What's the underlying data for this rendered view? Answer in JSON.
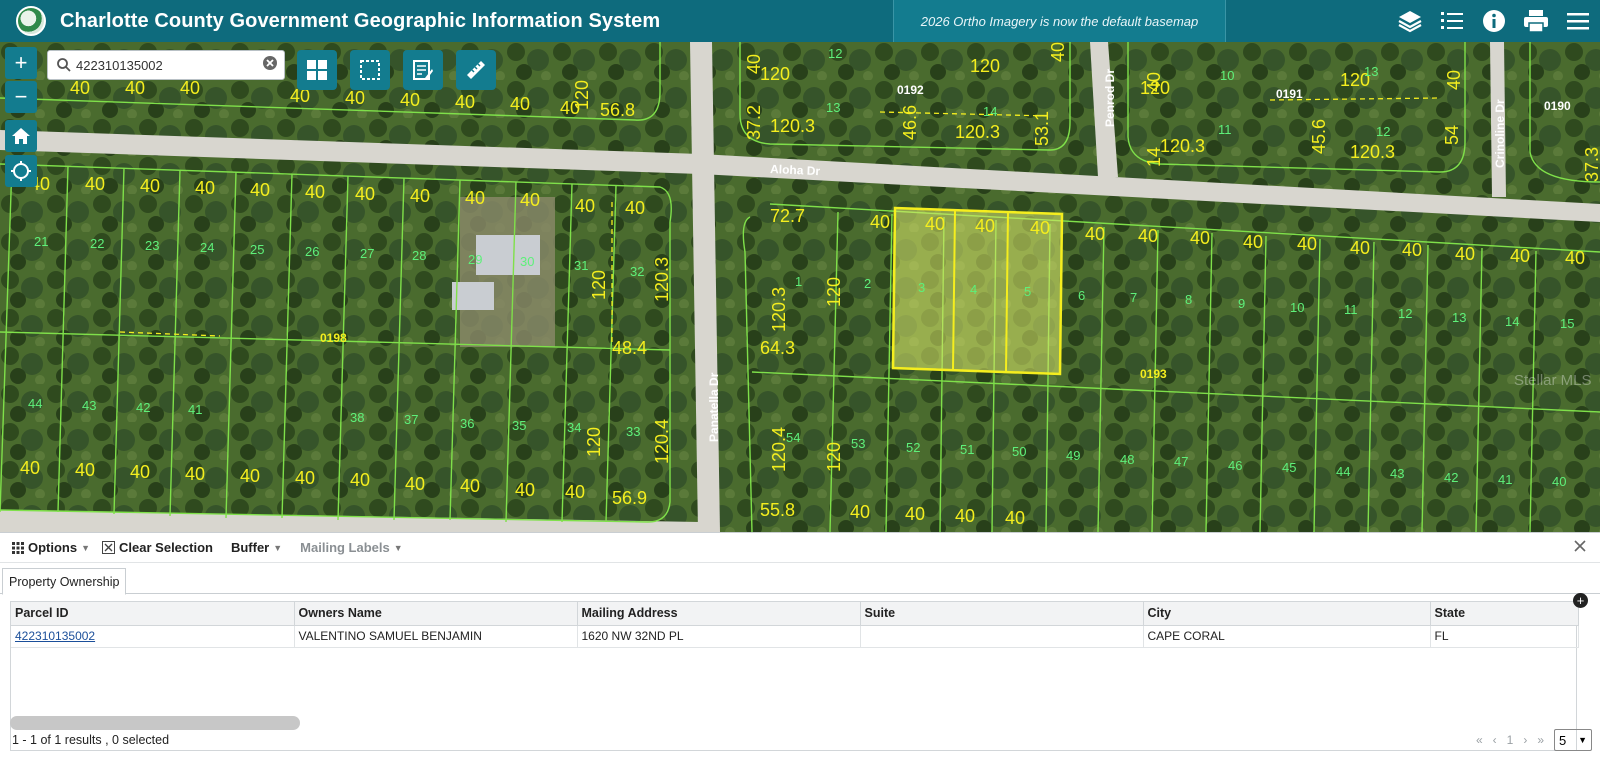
{
  "header": {
    "title": "Charlotte County Government Geographic Information System",
    "announcement": "2026 Ortho Imagery is now the default basemap",
    "icons": [
      "layers-icon",
      "list-icon",
      "info-icon",
      "print-icon",
      "menu-icon"
    ]
  },
  "map": {
    "zoom_in_label": "+",
    "zoom_out_label": "−",
    "search": {
      "value": "422310135002",
      "placeholder": "Search"
    },
    "tools": [
      "basemap-grid-icon",
      "select-area-icon",
      "notes-icon",
      "measure-icon"
    ],
    "streets": [
      "Aloha Dr",
      "Panatella Dr",
      "Penrod Dr",
      "Crinoline Dr"
    ],
    "blocks": [
      "0192",
      "0191",
      "0190",
      "0198",
      "0193"
    ],
    "watermark": "Stellar MLS",
    "colors": {
      "parcel_lines": "#7fe04a",
      "dimension_labels": "#f5ee1e",
      "selected_fill": "#d9e66a"
    }
  },
  "panel": {
    "toolbar": {
      "options": "Options",
      "clear_selection": "Clear Selection",
      "buffer": "Buffer",
      "mailing_labels": "Mailing Labels"
    },
    "tab": "Property Ownership",
    "columns": [
      "Parcel ID",
      "Owners Name",
      "Mailing Address",
      "Suite",
      "City",
      "State"
    ],
    "rows": [
      [
        "422310135002",
        "VALENTINO SAMUEL BENJAMIN",
        "1620 NW 32ND PL",
        "",
        "CAPE CORAL",
        "FL"
      ]
    ],
    "footer": "1 - 1 of 1 results , 0 selected",
    "pager": {
      "first": "«",
      "prev": "‹",
      "page": "1",
      "next": "›",
      "last": "»"
    },
    "page_size": "5"
  }
}
